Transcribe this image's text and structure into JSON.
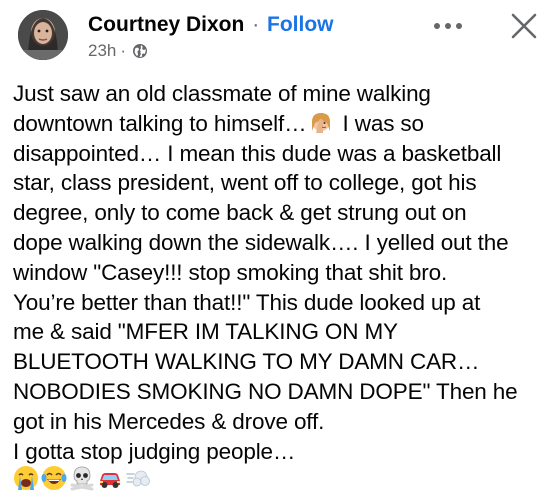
{
  "post": {
    "author": "Courtney Dixon",
    "separator": "·",
    "follow_label": "Follow",
    "timestamp": "23h",
    "meta_separator": "·",
    "privacy_icon": "globe-icon",
    "more_icon": "more-options-icon",
    "close_icon": "close-icon",
    "text_lines": [
      "Just saw an old classmate of mine walking",
      "downtown talking to himself…",
      " I was so",
      "disappointed… I mean this dude was a basketball",
      "star, class president, went off to college, got his",
      "degree, only to come back & get strung out on",
      "dope walking down the sidewalk…. I yelled out the",
      "window \"Casey!!! stop smoking that shit bro.",
      "You’re better than that!!\" This dude looked up at",
      "me & said \"MFER IM TALKING ON MY",
      "BLUETOOTH WALKING TO MY DAMN CAR…",
      "NOBODIES SMOKING NO DAMN DOPE\" Then he",
      "got in his Mercedes & drove off.",
      "I gotta stop judging people…"
    ],
    "inline_emoji": "woman-facepalming-emoji",
    "emoji_row": [
      "loudly-crying-face-emoji",
      "face-with-tears-of-joy-emoji",
      "skull-and-crossbones-emoji",
      "red-car-emoji",
      "dashing-away-emoji"
    ]
  },
  "colors": {
    "text": "#050505",
    "secondary": "#65676b",
    "link": "#1b74e4"
  }
}
